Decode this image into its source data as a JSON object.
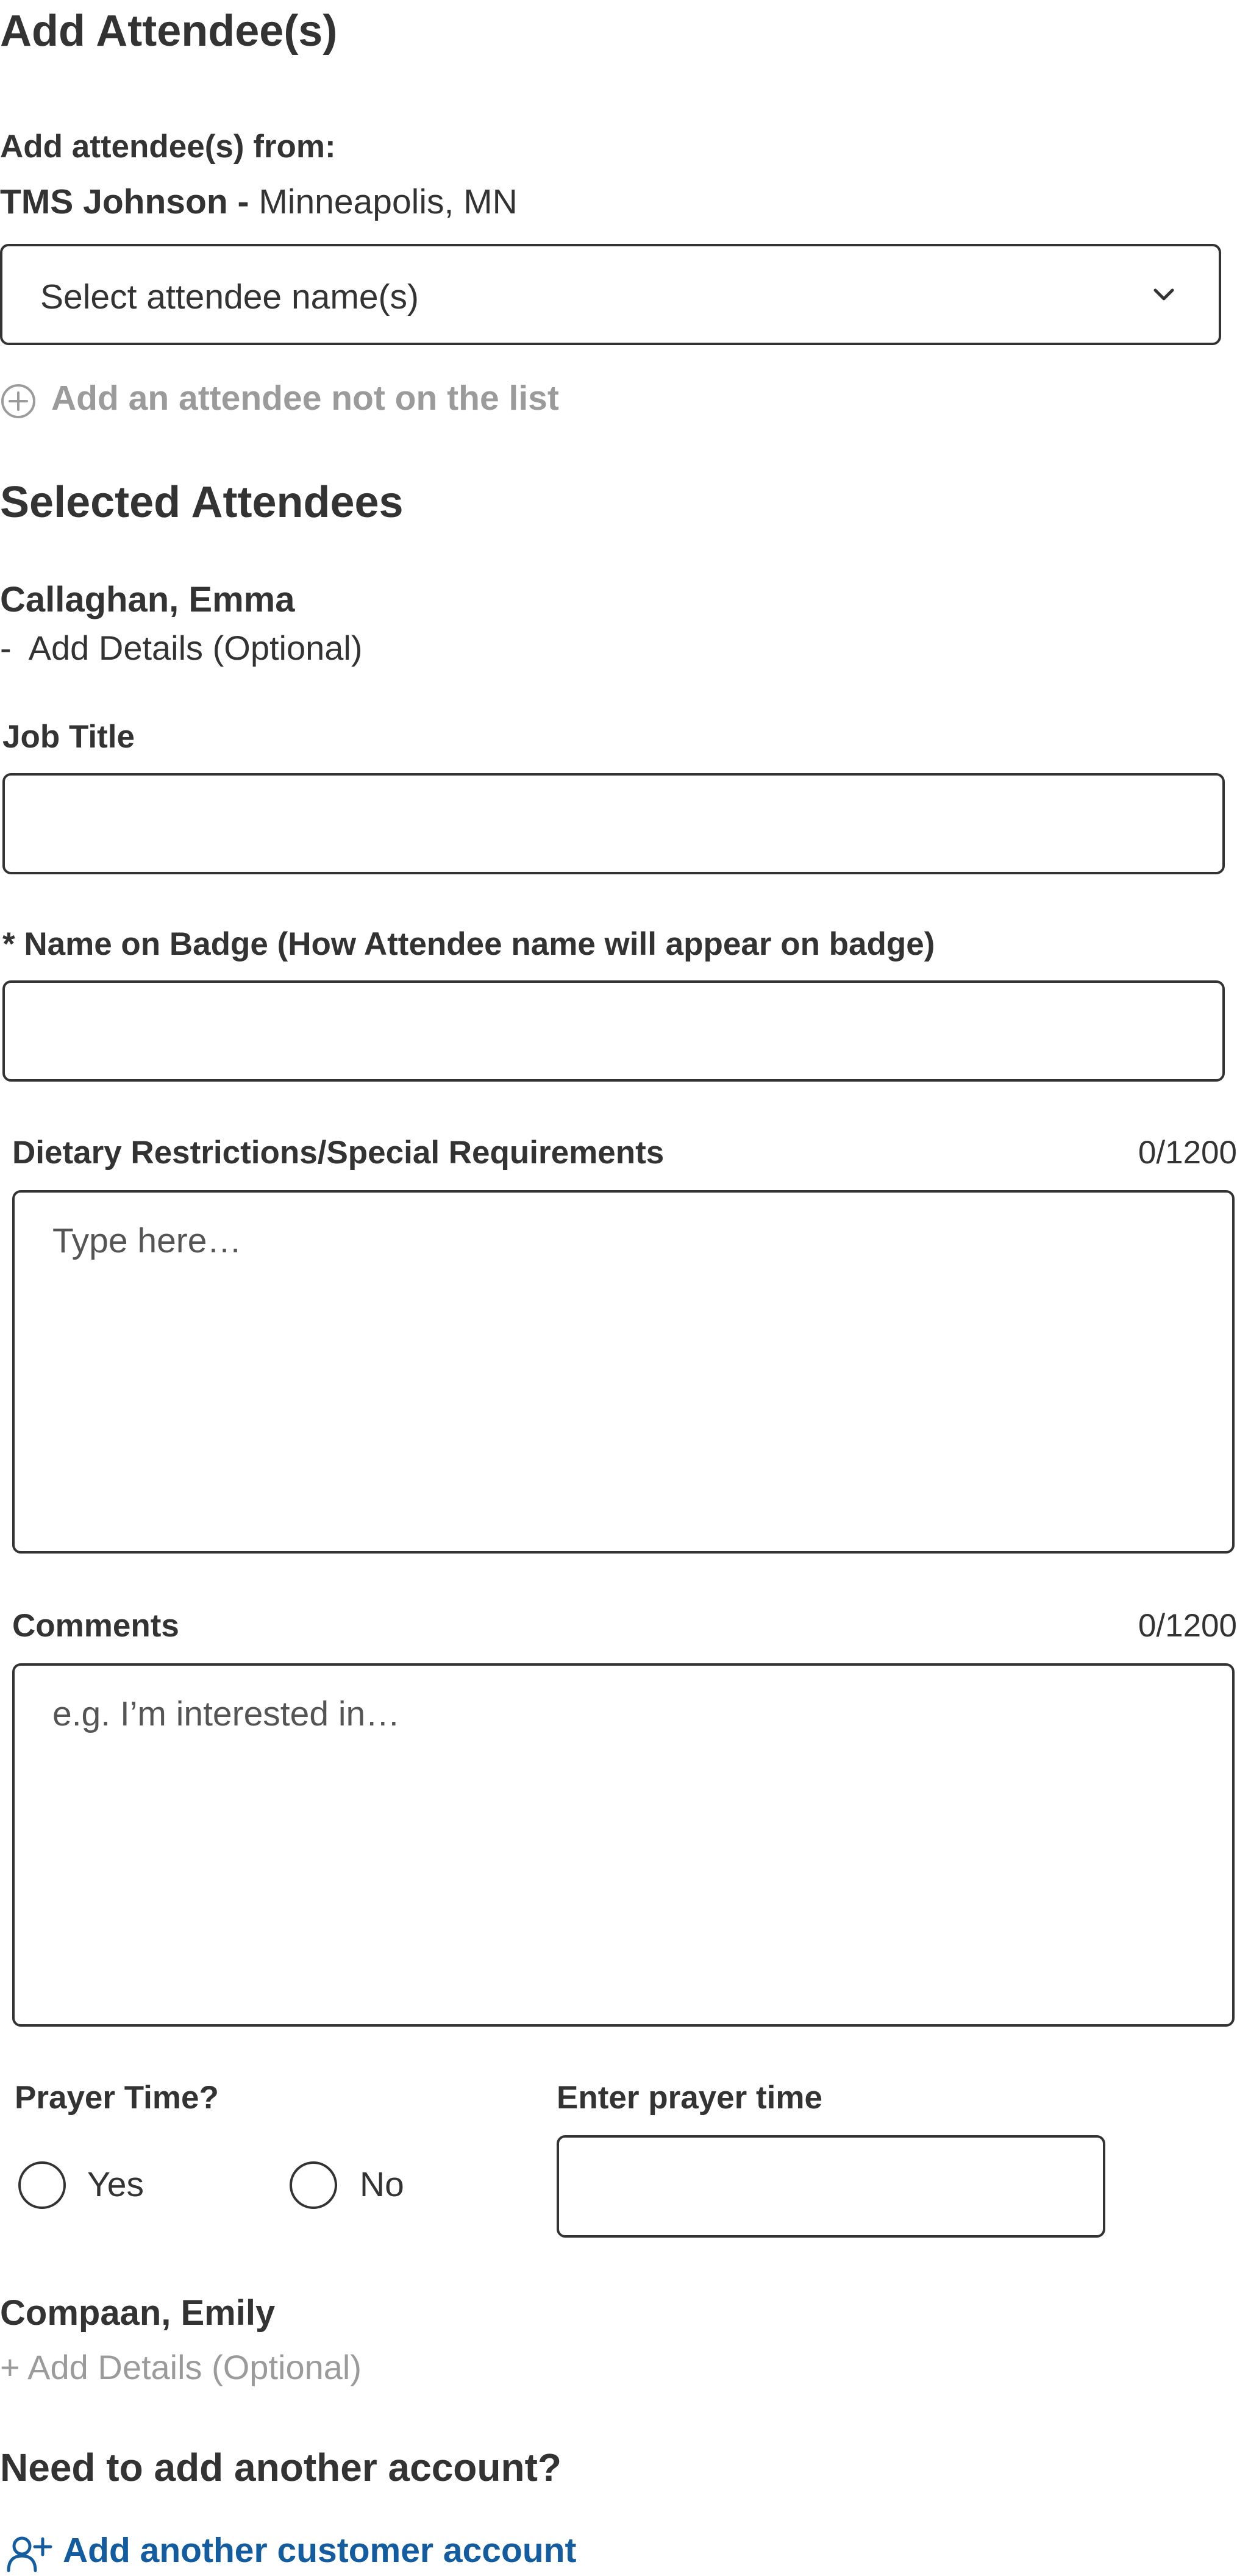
{
  "page": {
    "title": "Add Attendee(s)"
  },
  "source": {
    "prompt": "Add attendee(s) from:",
    "account_name": "TMS Johnson -",
    "account_location": "Minneapolis, MN"
  },
  "attendee_select": {
    "value": "Select attendee name(s)",
    "icon": "chevron-down-icon"
  },
  "add_not_on_list": {
    "label": "Add an attendee not on the list",
    "icon": "circle-plus-icon"
  },
  "selected": {
    "heading": "Selected Attendees",
    "attendees": [
      {
        "name": "Callaghan, Emma",
        "details_toggle": "-  Add Details (Optional)",
        "job_title": {
          "label": "Job Title",
          "value": ""
        },
        "badge_name": {
          "label": "* Name on Badge (How Attendee name will appear on badge)",
          "value": ""
        },
        "dietary": {
          "label": "Dietary Restrictions/Special Requirements",
          "counter": "0/1200",
          "placeholder": "Type here…"
        },
        "comments": {
          "label": "Comments",
          "counter": "0/1200",
          "placeholder": "e.g. I’m interested in…"
        },
        "prayer": {
          "label": "Prayer Time?",
          "options": [
            "Yes",
            "No"
          ],
          "selected": null,
          "time_label": "Enter prayer time",
          "time_value": ""
        }
      },
      {
        "name": "Compaan, Emily",
        "details_toggle": "+ Add Details (Optional)"
      }
    ]
  },
  "another_account": {
    "heading": "Need to add another account?",
    "link": "Add another customer account",
    "icon": "user-plus-icon",
    "link_color": "#135c9f"
  },
  "colors": {
    "text": "#333333",
    "muted": "#9b9b9b",
    "accent": "#135c9f",
    "border": "#333333"
  }
}
